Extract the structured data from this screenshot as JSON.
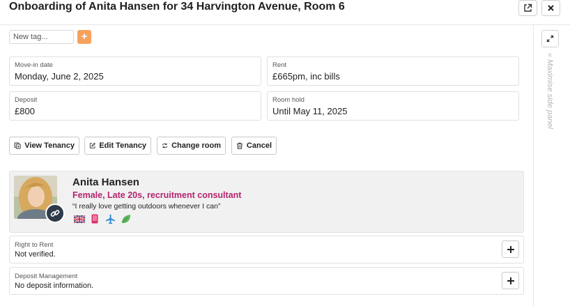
{
  "header": {
    "title": "Onboarding of Anita Hansen for 34 Harvington Avenue, Room 6",
    "open_icon": "external-link-icon",
    "close_icon": "close-icon"
  },
  "tags": {
    "placeholder": "New tag...",
    "add_label": "+"
  },
  "details": {
    "move_in": {
      "label": "Move-in date",
      "value": "Monday, June 2, 2025"
    },
    "rent": {
      "label": "Rent",
      "value": "£665pm, inc bills"
    },
    "deposit": {
      "label": "Deposit",
      "value": "£800"
    },
    "room_hold": {
      "label": "Room hold",
      "value": "Until May 11, 2025"
    }
  },
  "actions": {
    "view_tenancy": "View Tenancy",
    "edit_tenancy": "Edit Tenancy",
    "change_room": "Change room",
    "cancel": "Cancel"
  },
  "profile": {
    "name": "Anita Hansen",
    "description": "Female, Late 20s, recruitment consultant",
    "quote": "“I really love getting outdoors whenever I can”",
    "badge_icon": "link-icon",
    "icons": [
      "uk-flag-icon",
      "phone-icon",
      "airplane-icon",
      "leaf-icon"
    ]
  },
  "right_to_rent": {
    "label": "Right to Rent",
    "value": "Not verified."
  },
  "deposit_management": {
    "label": "Deposit Management",
    "value": "No deposit information."
  },
  "side_panel": {
    "maximise_label": "« Maximise side panel"
  },
  "colors": {
    "accent_orange": "#f6a25c",
    "profile_magenta": "#b3246f",
    "badge_navy": "#2e3a4a"
  }
}
